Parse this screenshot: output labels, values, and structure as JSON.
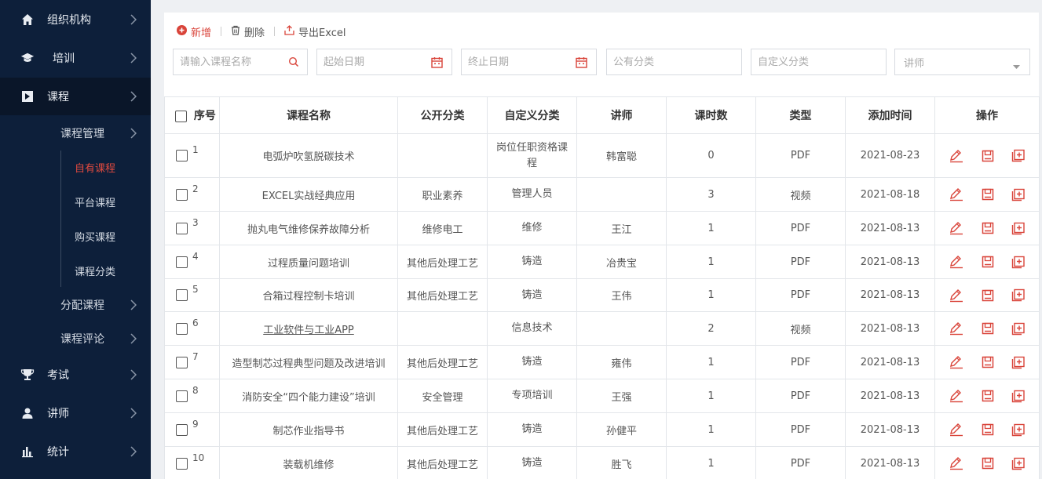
{
  "sidebar": {
    "items": [
      {
        "label": "组织机构",
        "icon": "home-icon"
      },
      {
        "label": "培训",
        "icon": "graduation-cap-icon"
      },
      {
        "label": "课程",
        "icon": "play-square-icon"
      },
      {
        "label": "考试",
        "icon": "trophy-icon"
      },
      {
        "label": "讲师",
        "icon": "user-icon"
      },
      {
        "label": "统计",
        "icon": "bar-chart-icon"
      }
    ],
    "course_sub": [
      {
        "label": "课程管理"
      },
      {
        "label": "分配课程"
      },
      {
        "label": "课程评论"
      }
    ],
    "course_mgmt_sub": [
      {
        "label": "自有课程",
        "active": true
      },
      {
        "label": "平台课程"
      },
      {
        "label": "购买课程"
      },
      {
        "label": "课程分类"
      }
    ]
  },
  "toolbar": {
    "add_label": "新增",
    "delete_label": "删除",
    "export_label": "导出Excel"
  },
  "filters": {
    "course_name_placeholder": "请输入课程名称",
    "start_date_placeholder": "起始日期",
    "end_date_placeholder": "终止日期",
    "public_category_placeholder": "公有分类",
    "custom_category_placeholder": "自定义分类",
    "lecturer_placeholder": "讲师"
  },
  "table": {
    "headers": [
      "序号",
      "课程名称",
      "公开分类",
      "自定义分类",
      "讲师",
      "课时数",
      "类型",
      "添加时间",
      "操作"
    ],
    "rows": [
      {
        "idx": "1",
        "name": "电弧炉吹氢脱碳技术",
        "public": "",
        "custom": "岗位任职资格课程",
        "lecturer": "韩富聪",
        "hours": "0",
        "type": "PDF",
        "date": "2021-08-23"
      },
      {
        "idx": "2",
        "name": "EXCEL实战经典应用",
        "public": "职业素养",
        "custom": "管理人员",
        "lecturer": "",
        "hours": "3",
        "type": "视频",
        "date": "2021-08-18"
      },
      {
        "idx": "3",
        "name": "抛丸电气维修保养故障分析",
        "public": "维修电工",
        "custom": "维修",
        "lecturer": "王江",
        "hours": "1",
        "type": "PDF",
        "date": "2021-08-13"
      },
      {
        "idx": "4",
        "name": "过程质量问题培训",
        "public": "其他后处理工艺",
        "custom": "铸造",
        "lecturer": "冶贵宝",
        "hours": "1",
        "type": "PDF",
        "date": "2021-08-13"
      },
      {
        "idx": "5",
        "name": "合箱过程控制卡培训",
        "public": "其他后处理工艺",
        "custom": "铸造",
        "lecturer": "王伟",
        "hours": "1",
        "type": "PDF",
        "date": "2021-08-13"
      },
      {
        "idx": "6",
        "name": "工业软件与工业APP",
        "public": "",
        "custom": "信息技术",
        "lecturer": "",
        "hours": "2",
        "type": "视频",
        "date": "2021-08-13"
      },
      {
        "idx": "7",
        "name": "造型制芯过程典型问题及改进培训",
        "public": "其他后处理工艺",
        "custom": "铸造",
        "lecturer": "雍伟",
        "hours": "1",
        "type": "PDF",
        "date": "2021-08-13"
      },
      {
        "idx": "8",
        "name": "消防安全“四个能力建设”培训",
        "public": "安全管理",
        "custom": "专项培训",
        "lecturer": "王强",
        "hours": "1",
        "type": "PDF",
        "date": "2021-08-13"
      },
      {
        "idx": "9",
        "name": "制芯作业指导书",
        "public": "其他后处理工艺",
        "custom": "铸造",
        "lecturer": "孙健平",
        "hours": "1",
        "type": "PDF",
        "date": "2021-08-13"
      },
      {
        "idx": "10",
        "name": "装载机维修",
        "public": "其他后处理工艺",
        "custom": "铸造",
        "lecturer": "胜飞",
        "hours": "1",
        "type": "PDF",
        "date": "2021-08-13"
      }
    ]
  },
  "colors": {
    "sidebar_bg": "#0d1f3a",
    "accent_red": "#d9443a"
  }
}
